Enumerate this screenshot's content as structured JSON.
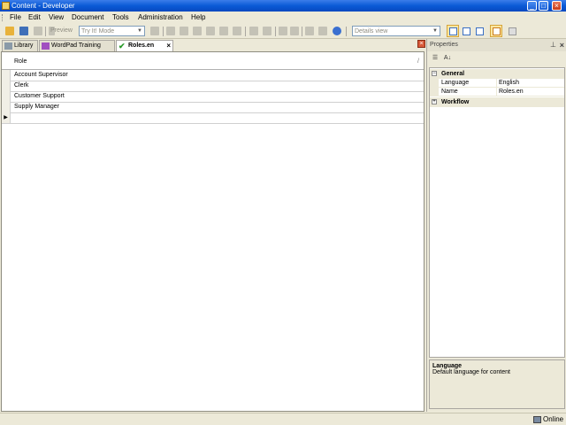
{
  "window": {
    "title": "Content - Developer",
    "minimize_glyph": "_",
    "maximize_glyph": "□",
    "close_glyph": "×"
  },
  "menu": [
    "File",
    "Edit",
    "View",
    "Document",
    "Tools",
    "Administration",
    "Help"
  ],
  "toolbar": {
    "preview_label": "Preview",
    "mode_combo": "Try It! Mode",
    "view_combo": "Details view",
    "icons": [
      "new-folder-icon",
      "save-icon",
      "print-icon",
      "cut-icon",
      "copy-icon",
      "paste-icon",
      "delete-icon",
      "undo-icon",
      "redo-icon",
      "find-icon",
      "help-icon"
    ]
  },
  "tabs": [
    {
      "label": "Library",
      "icon": "library-icon"
    },
    {
      "label": "WordPad Training",
      "icon": "wordpad-icon"
    },
    {
      "label": "Roles.en",
      "icon": "roles-check-icon",
      "active": true
    }
  ],
  "tab_close_glyph": "×",
  "grid": {
    "column_header": "Role",
    "sort_glyph": "/",
    "rows": [
      "Account Supervisor",
      "Clerk",
      "Customer Support",
      "Supply Manager"
    ],
    "new_row_marker": "▶"
  },
  "properties": {
    "title": "Properties",
    "pin_glyph": "⊥",
    "close_glyph": "×",
    "toolbar": {
      "categorized_glyph": "☰",
      "alpha_glyph": "A↓"
    },
    "categories": [
      {
        "name": "General",
        "toggle": "−",
        "rows": [
          {
            "name": "Language",
            "value": "English"
          },
          {
            "name": "Name",
            "value": "Roles.en"
          }
        ]
      },
      {
        "name": "Workflow",
        "toggle": "+",
        "rows": []
      }
    ],
    "description": {
      "title": "Language",
      "text": "Default language for content"
    }
  },
  "status": {
    "text": "Online"
  }
}
